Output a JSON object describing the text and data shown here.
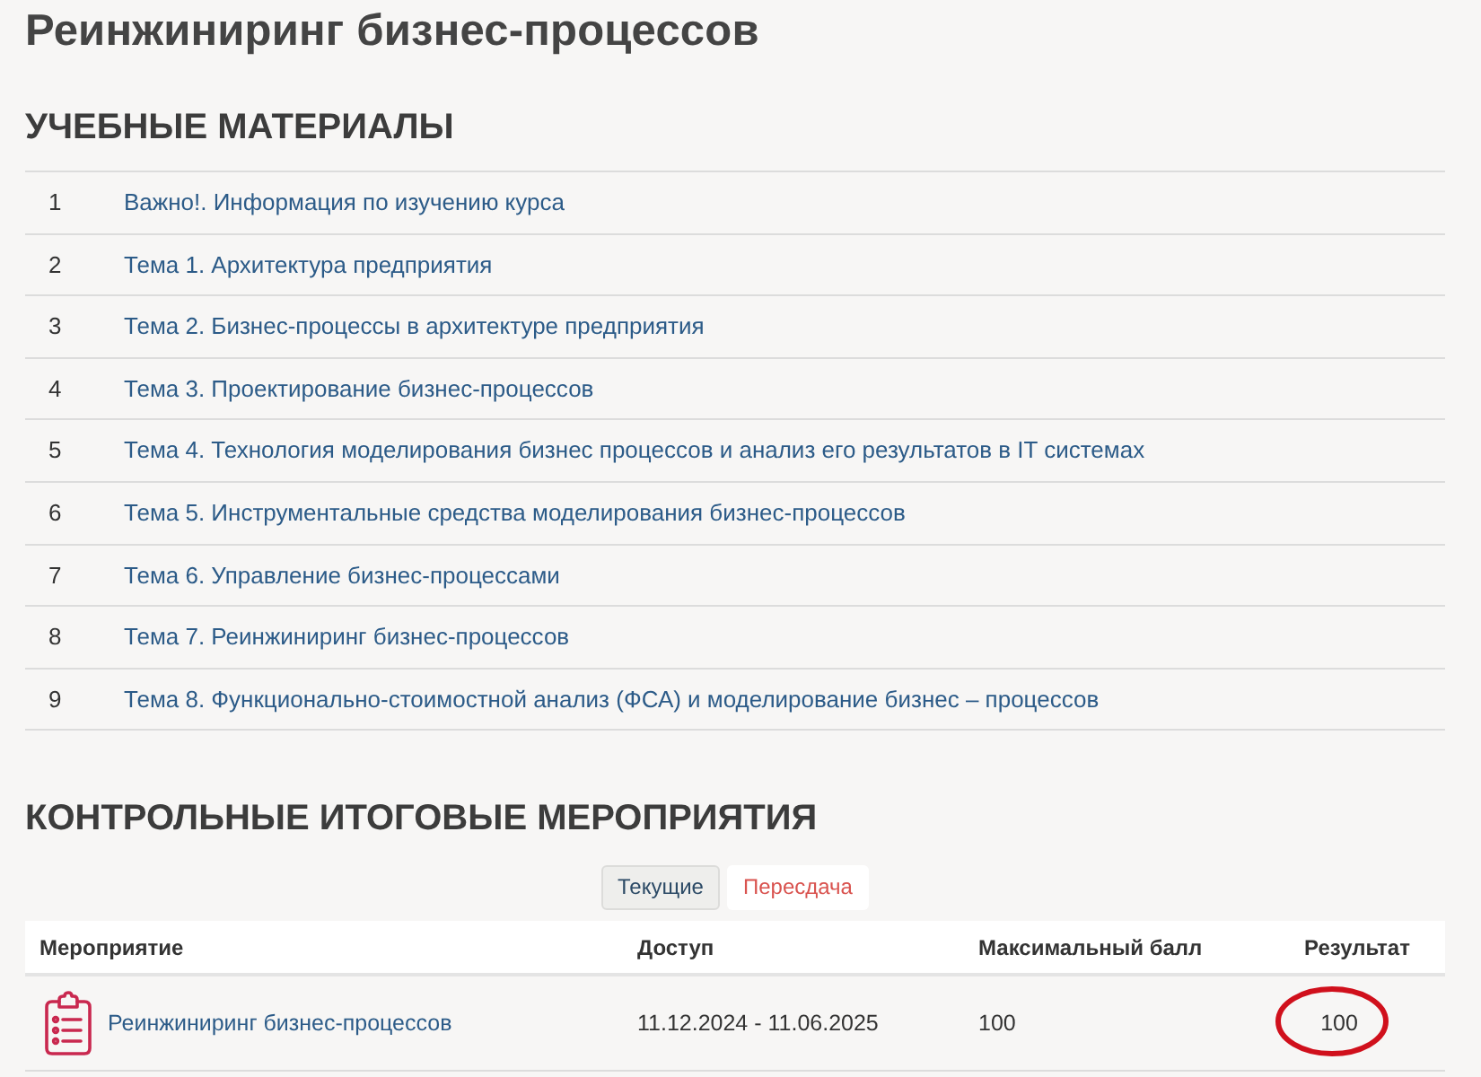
{
  "page_title": "Реинжиниринг бизнес-процессов",
  "materials": {
    "heading": "УЧЕБНЫЕ МАТЕРИАЛЫ",
    "rows": [
      {
        "number": "1",
        "title": "Важно!. Информация по изучению курса"
      },
      {
        "number": "2",
        "title": "Тема 1. Архитектура предприятия"
      },
      {
        "number": "3",
        "title": "Тема 2. Бизнес-процессы в архитектуре предприятия"
      },
      {
        "number": "4",
        "title": "Тема 3. Проектирование бизнес-процессов"
      },
      {
        "number": "5",
        "title": "Тема 4. Технология моделирования бизнес процессов и анализ его результатов в IT системах"
      },
      {
        "number": "6",
        "title": "Тема 5. Инструментальные средства моделирования бизнес-процессов"
      },
      {
        "number": "7",
        "title": "Тема 6. Управление бизнес-процессами"
      },
      {
        "number": "8",
        "title": "Тема 7. Реинжиниринг бизнес-процессов"
      },
      {
        "number": "9",
        "title": "Тема 8. Функционально-стоимостной анализ (ФСА) и моделирование бизнес – процессов"
      }
    ]
  },
  "activities": {
    "heading": "КОНТРОЛЬНЫЕ ИТОГОВЫЕ МЕРОПРИЯТИЯ",
    "filters": [
      {
        "label": "Текущие",
        "selected": true
      },
      {
        "label": "Пересдача",
        "selected": false
      }
    ],
    "columns": [
      "Мероприятие",
      "Доступ",
      "Максимальный балл",
      "Результат"
    ],
    "rows": [
      {
        "title": "Реинжиниринг бизнес-процессов",
        "access": "11.12.2024 - 11.06.2025",
        "max_score": "100",
        "result": "100",
        "circled": true
      }
    ]
  }
}
